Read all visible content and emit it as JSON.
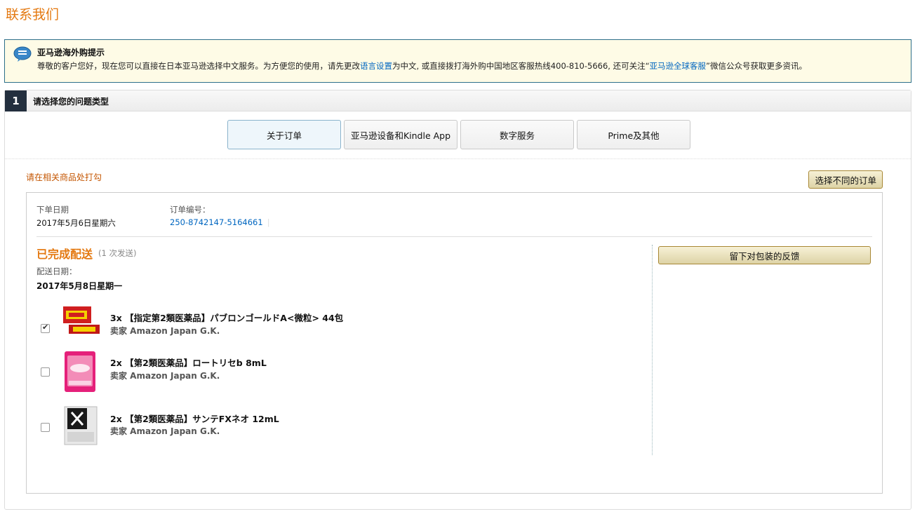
{
  "page": {
    "title": "联系我们"
  },
  "notice": {
    "title": "亚马逊海外购提示",
    "body_part1": "尊敬的客户您好，现在您可以直接在日本亚马逊选择中文服务。为方便您的使用，请先更改",
    "link_language": "语言设置",
    "body_part2": "为中文, 或直接拨打海外购中国地区客服热线400-810-5666, 还可关注“",
    "link_service": "亚马逊全球客服",
    "body_part3": "”微信公众号获取更多资讯。"
  },
  "step": {
    "number": "1",
    "label": "请选择您的问题类型",
    "tabs": [
      {
        "label": "关于订单",
        "active": true
      },
      {
        "label": "亚马逊设备和Kindle App",
        "active": false
      },
      {
        "label": "数字服务",
        "active": false
      },
      {
        "label": "Prime及其他",
        "active": false
      }
    ]
  },
  "order_section": {
    "hint": "请在相关商品处打勾",
    "select_other_button": "选择不同的订单",
    "order_date_label": "下单日期",
    "order_date": "2017年5月6日星期六",
    "order_number_label": "订单编号：",
    "order_number": "250-8742147-5164661",
    "pipe": "|",
    "shipment_status": "已完成配送",
    "shipment_count": "(1 次发送)",
    "delivery_date_label": "配送日期：",
    "delivery_date": "2017年5月8日星期一",
    "feedback_button": "留下对包装的反馈",
    "items": [
      {
        "title": "3x 【指定第2類医薬品】パブロンゴールドA<微粒> 44包",
        "seller": "卖家 Amazon Japan G.K.",
        "checked": true
      },
      {
        "title": "2x 【第2類医薬品】ロートリセb 8mL",
        "seller": "卖家 Amazon Japan G.K.",
        "checked": false
      },
      {
        "title": "2x 【第2類医薬品】サンテFXネオ 12mL",
        "seller": "卖家 Amazon Japan G.K.",
        "checked": false
      }
    ]
  },
  "colors": {
    "accent": "#e47911",
    "link": "#0066c0",
    "step_dark": "#232f3e",
    "notice_bg": "#fefbe6"
  },
  "icons": {
    "notice": "speech-bubble-icon",
    "checkbox_checked": "check-icon"
  }
}
